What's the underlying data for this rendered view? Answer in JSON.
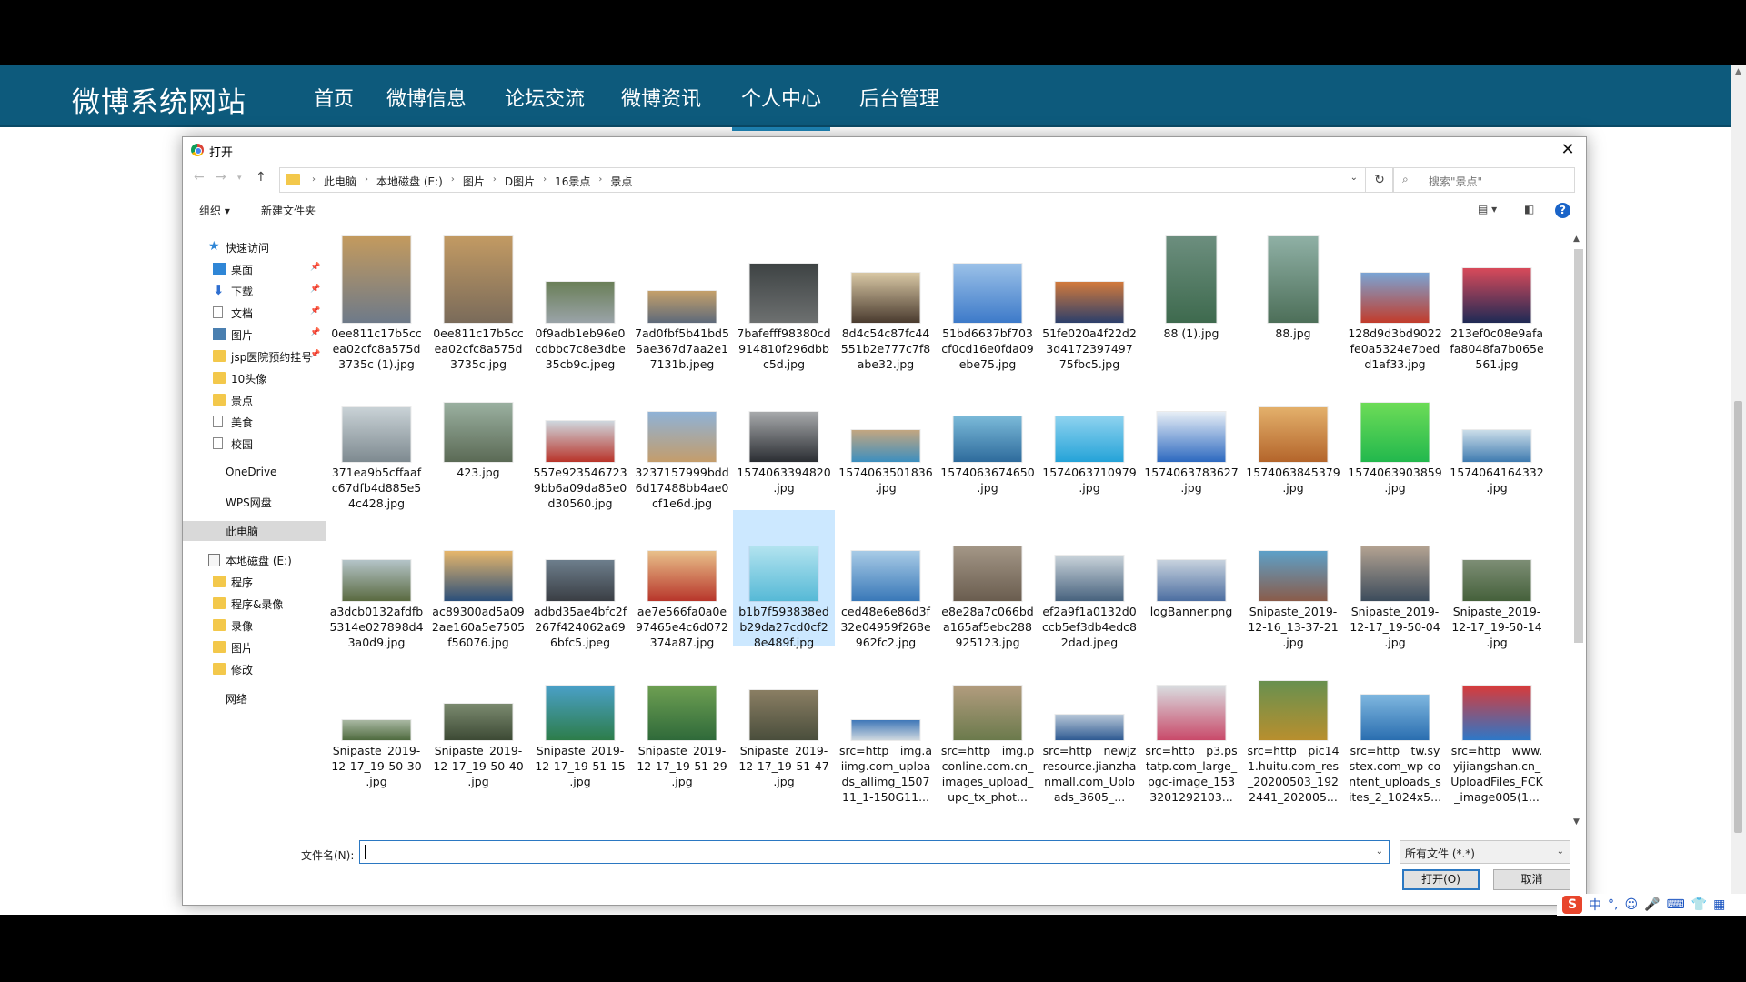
{
  "site": {
    "brand": "微博系统网站",
    "nav": [
      "首页",
      "微博信息",
      "论坛交流",
      "微博资讯",
      "个人中心",
      "后台管理"
    ],
    "active_nav": "个人中心"
  },
  "dialog": {
    "title": "打开",
    "close": "✕",
    "breadcrumb": [
      "此电脑",
      "本地磁盘 (E:)",
      "图片",
      "D图片",
      "16景点",
      "景点"
    ],
    "search_placeholder": "搜索\"景点\"",
    "toolbar": {
      "organize": "组织 ▾",
      "new_folder": "新建文件夹",
      "help": "?"
    },
    "nav_items": [
      {
        "label": "快速访问",
        "icon": "star-icon"
      },
      {
        "label": "桌面",
        "icon": "desktop-icon",
        "pinned": true
      },
      {
        "label": "下载",
        "icon": "download-icon",
        "pinned": true
      },
      {
        "label": "文档",
        "icon": "document-icon",
        "pinned": true
      },
      {
        "label": "图片",
        "icon": "pictures-icon",
        "pinned": true
      },
      {
        "label": "jsp医院预约挂号",
        "icon": "folder-icon",
        "pinned": true
      },
      {
        "label": "10头像",
        "icon": "folder-icon"
      },
      {
        "label": "景点",
        "icon": "folder-icon"
      },
      {
        "label": "美食",
        "icon": "page-icon"
      },
      {
        "label": "校园",
        "icon": "page-icon"
      },
      {
        "label": "OneDrive",
        "icon": ""
      },
      {
        "label": "WPS网盘",
        "icon": ""
      },
      {
        "label": "此电脑",
        "icon": ""
      },
      {
        "label": "本地磁盘 (E:)",
        "icon": "drive-icon"
      },
      {
        "label": "程序",
        "icon": "folder-icon"
      },
      {
        "label": "程序&录像",
        "icon": "folder-icon"
      },
      {
        "label": "录像",
        "icon": "folder-icon"
      },
      {
        "label": "图片",
        "icon": "folder-icon"
      },
      {
        "label": "修改",
        "icon": "folder-icon"
      },
      {
        "label": "网络",
        "icon": ""
      }
    ],
    "files": [
      "0ee811c17b5ccea02cfc8a575d3735c (1).jpg",
      "0ee811c17b5ccea02cfc8a575d3735c.jpg",
      "0f9adb1eb96e0cdbbc7c8e3dbe35cb9c.jpeg",
      "7ad0fbf5b41bd55ae367d7aa2e17131b.jpeg",
      "7bafefff98380cd914810f296dbbc5d.jpg",
      "8d4c54c87fc44551b2e777c7f8abe32.jpg",
      "51bd6637bf703cf0cd16e0fda09ebe75.jpg",
      "51fe020a4f22d23d4172397497 75fbc5.jpg",
      "88 (1).jpg",
      "88.jpg",
      "128d9d3bd9022fe0a5324e7bedd1af33.jpg",
      "213ef0c08e9afafa8048fa7b065e561.jpg",
      "371ea9b5cffaafc67dfb4d885e54c428.jpg",
      "423.jpg",
      "557e9235467239bb6a09da85e0d30560.jpg",
      "3237157999bdd6d17488bb4ae0cf1e6d.jpg",
      "1574063394820 .jpg",
      "1574063501836 .jpg",
      "1574063674650 .jpg",
      "1574063710979 .jpg",
      "1574063783627 .jpg",
      "1574063845379 .jpg",
      "1574063903859 .jpg",
      "1574064164332 .jpg",
      "a3dcb0132afdfb5314e027898d43a0d9.jpg",
      "ac89300ad5a092ae160a5e7505f56076.jpg",
      "adbd35ae4bfc2f267f424062a696bfc5.jpeg",
      "ae7e566fa0a0e97465e4c6d072374a87.jpg",
      "b1b7f593838edb29da27cd0cf28e489f.jpg",
      "ced48e6e86d3f32e04959f268e962fc2.jpg",
      "e8e28a7c066bda165af5ebc288925123.jpg",
      "ef2a9f1a0132d0ccb5ef3db4edc82dad.jpeg",
      "logBanner.png",
      "Snipaste_2019-12-16_13-37-21 .jpg",
      "Snipaste_2019-12-17_19-50-04 .jpg",
      "Snipaste_2019-12-17_19-50-14 .jpg",
      "Snipaste_2019-12-17_19-50-30 .jpg",
      "Snipaste_2019-12-17_19-50-40 .jpg",
      "Snipaste_2019-12-17_19-51-15 .jpg",
      "Snipaste_2019-12-17_19-51-29 .jpg",
      "Snipaste_2019-12-17_19-51-47 .jpg",
      "src=http__img.aiimg.com_uploads_allimg_150711_1-150G11...",
      "src=http__img.pconline.com.cn_images_upload_upc_tx_phot...",
      "src=http__newjzresource.jianzhanmall.com_Uploads_3605_...",
      "src=http__p3.pstatp.com_large_pgc-image_1533201292103...",
      "src=http__pic141.huitu.com_res_20200503_1922441_202005...",
      "src=http__tw.systex.com_wp-content_uploads_sites_2_1024x5...",
      "src=http__www.yijiangshan.cn_UploadFiles_FCK_image005(1..."
    ],
    "selected_file_index": 28,
    "filename_label": "文件名(N):",
    "filename_value": "",
    "filetype": "所有文件 (*.*)",
    "open_button": "打开(O)",
    "cancel_button": "取消"
  },
  "ime": {
    "items": [
      "中",
      "°,",
      "☺",
      "🎤",
      "⌨",
      "👕",
      "👕",
      "▦"
    ]
  },
  "thumb_colors": [
    [
      "#6e7a89",
      "#c39a5e"
    ],
    [
      "#7a6b5a",
      "#c29a63"
    ],
    [
      "#9aa3a8",
      "#6a7f58"
    ],
    [
      "#5e6a7a",
      "#c4a06a"
    ],
    [
      "#6d7070",
      "#3e4344"
    ],
    [
      "#4a3b2f",
      "#d8c7a4"
    ],
    [
      "#3d7ac9",
      "#9bc1e8"
    ],
    [
      "#2c3f6b",
      "#d27a3c"
    ],
    [
      "#3e6a4e",
      "#6c8e7e"
    ],
    [
      "#4d6f59",
      "#8fb0a5"
    ],
    [
      "#c23c2b",
      "#7aa4d4"
    ],
    [
      "#1f2a55",
      "#d84a5a"
    ],
    [
      "#7e8a90",
      "#c9d2d6"
    ],
    [
      "#5b6a55",
      "#9ab0a0"
    ],
    [
      "#b9342a",
      "#cfd7de"
    ],
    [
      "#c49d6b",
      "#8fb2d6"
    ],
    [
      "#2b2e33",
      "#a7a9ab"
    ],
    [
      "#3c8fbf",
      "#c3a680"
    ],
    [
      "#2e6b9c",
      "#7ab9d8"
    ],
    [
      "#25a3d8",
      "#8dd2ef"
    ],
    [
      "#2d69c0",
      "#e7eef6"
    ],
    [
      "#b4652b",
      "#e3b06b"
    ],
    [
      "#22b84d",
      "#6ddc57"
    ],
    [
      "#3f7bb0",
      "#cbdde9"
    ],
    [
      "#5a6a40",
      "#b4c4c8"
    ],
    [
      "#2b4f7a",
      "#e6b66b"
    ],
    [
      "#3a3e44",
      "#6d7e8c"
    ],
    [
      "#b8362b",
      "#e8c08a"
    ],
    [
      "#56b9d6",
      "#b2e3ef"
    ],
    [
      "#3978b8",
      "#a8cbe6"
    ],
    [
      "#6a5d4f",
      "#a39686"
    ],
    [
      "#47627e",
      "#c9d3da"
    ],
    [
      "#4c6ea1",
      "#c7d2de"
    ],
    [
      "#8a5c4a",
      "#5da0c8"
    ],
    [
      "#3c4c5c",
      "#b3a291"
    ],
    [
      "#45613b",
      "#7d8e75"
    ],
    [
      "#4f6b3f",
      "#a9b8a3"
    ],
    [
      "#3d4a35",
      "#7b8a6f"
    ],
    [
      "#2d7d4a",
      "#4aa0c8"
    ],
    [
      "#2f6a3a",
      "#6e9f52"
    ],
    [
      "#4a4e3c",
      "#8a7e63"
    ],
    [
      "#cfd8df",
      "#3f77b8"
    ],
    [
      "#6b7a4c",
      "#b29c7e"
    ],
    [
      "#2f5a92",
      "#b8c8d8"
    ],
    [
      "#c94a6a",
      "#d9dde0"
    ],
    [
      "#b88f2e",
      "#68904f"
    ],
    [
      "#2a6eb0",
      "#7fb7df"
    ],
    [
      "#2e77c7",
      "#d83a3a"
    ]
  ]
}
